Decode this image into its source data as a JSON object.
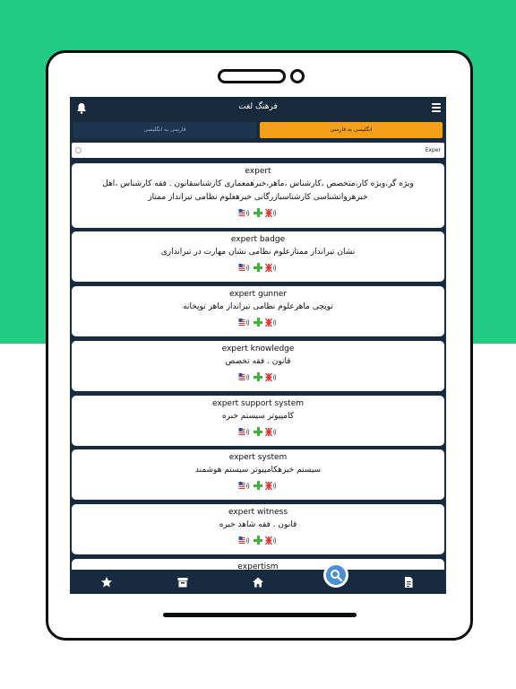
{
  "app": {
    "title": "فرهنگ لغت"
  },
  "tabs": {
    "fa_to_en": "فارسی به انگلیسی",
    "en_to_fa": "انگلیسی به فارسی",
    "active": "en_to_fa"
  },
  "search": {
    "value": "Exper"
  },
  "results": [
    {
      "word": "expert",
      "meaning": "ویژه گر،ویژه کار،متخصص ،کارشناس ،ماهر،خبرهمعماری  کارشناسقانون . فقه  کارشناس ،اهل خبرهروانشناسی  کارشناسبازرگانی  خبرهعلوم نظامی  تیرانداز ممتاز"
    },
    {
      "word": "expert badge",
      "meaning": "نشان تیرانداز ممتازعلوم نظامی  نشان مهارت در تیراندازی"
    },
    {
      "word": "expert gunner",
      "meaning": "توپچی ماهرعلوم نظامی  تیرانداز ماهر توپخانه"
    },
    {
      "word": "expert knowledge",
      "meaning": "قانون . فقه  تخصص"
    },
    {
      "word": "expert support system",
      "meaning": "کامپیوتر  سیستم خبره"
    },
    {
      "word": "expert system",
      "meaning": "سیستم خبرهکامپیوتر  سیستم هوشمند"
    },
    {
      "word": "expert witness",
      "meaning": "قانون . فقه  شاهد خبره"
    },
    {
      "word": "expertism",
      "meaning": ""
    }
  ],
  "nav": {
    "items": [
      "favorites-icon",
      "archive-icon",
      "home-icon",
      "search-icon",
      "document-icon"
    ],
    "active": "search-icon"
  },
  "colors": {
    "background_green": "#22cc85",
    "screen_navy": "#172a3f",
    "active_tab_orange": "#f6a018",
    "add_green": "#40b23a",
    "fab_blue": "#4a90d9"
  }
}
